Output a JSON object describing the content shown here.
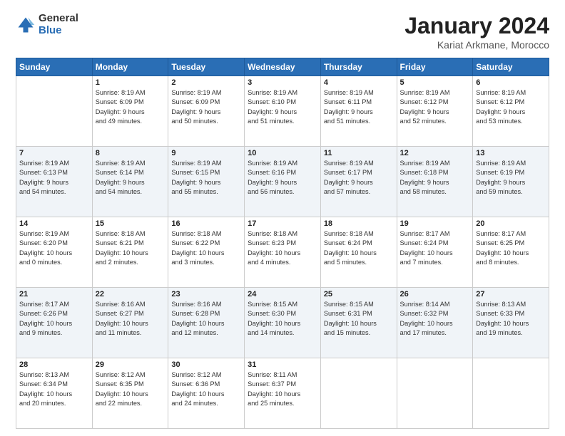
{
  "header": {
    "logo_general": "General",
    "logo_blue": "Blue",
    "title": "January 2024",
    "location": "Kariat Arkmane, Morocco"
  },
  "weekdays": [
    "Sunday",
    "Monday",
    "Tuesday",
    "Wednesday",
    "Thursday",
    "Friday",
    "Saturday"
  ],
  "weeks": [
    [
      {
        "day": "",
        "info": ""
      },
      {
        "day": "1",
        "info": "Sunrise: 8:19 AM\nSunset: 6:09 PM\nDaylight: 9 hours\nand 49 minutes."
      },
      {
        "day": "2",
        "info": "Sunrise: 8:19 AM\nSunset: 6:09 PM\nDaylight: 9 hours\nand 50 minutes."
      },
      {
        "day": "3",
        "info": "Sunrise: 8:19 AM\nSunset: 6:10 PM\nDaylight: 9 hours\nand 51 minutes."
      },
      {
        "day": "4",
        "info": "Sunrise: 8:19 AM\nSunset: 6:11 PM\nDaylight: 9 hours\nand 51 minutes."
      },
      {
        "day": "5",
        "info": "Sunrise: 8:19 AM\nSunset: 6:12 PM\nDaylight: 9 hours\nand 52 minutes."
      },
      {
        "day": "6",
        "info": "Sunrise: 8:19 AM\nSunset: 6:12 PM\nDaylight: 9 hours\nand 53 minutes."
      }
    ],
    [
      {
        "day": "7",
        "info": "Sunrise: 8:19 AM\nSunset: 6:13 PM\nDaylight: 9 hours\nand 54 minutes."
      },
      {
        "day": "8",
        "info": "Sunrise: 8:19 AM\nSunset: 6:14 PM\nDaylight: 9 hours\nand 54 minutes."
      },
      {
        "day": "9",
        "info": "Sunrise: 8:19 AM\nSunset: 6:15 PM\nDaylight: 9 hours\nand 55 minutes."
      },
      {
        "day": "10",
        "info": "Sunrise: 8:19 AM\nSunset: 6:16 PM\nDaylight: 9 hours\nand 56 minutes."
      },
      {
        "day": "11",
        "info": "Sunrise: 8:19 AM\nSunset: 6:17 PM\nDaylight: 9 hours\nand 57 minutes."
      },
      {
        "day": "12",
        "info": "Sunrise: 8:19 AM\nSunset: 6:18 PM\nDaylight: 9 hours\nand 58 minutes."
      },
      {
        "day": "13",
        "info": "Sunrise: 8:19 AM\nSunset: 6:19 PM\nDaylight: 9 hours\nand 59 minutes."
      }
    ],
    [
      {
        "day": "14",
        "info": "Sunrise: 8:19 AM\nSunset: 6:20 PM\nDaylight: 10 hours\nand 0 minutes."
      },
      {
        "day": "15",
        "info": "Sunrise: 8:18 AM\nSunset: 6:21 PM\nDaylight: 10 hours\nand 2 minutes."
      },
      {
        "day": "16",
        "info": "Sunrise: 8:18 AM\nSunset: 6:22 PM\nDaylight: 10 hours\nand 3 minutes."
      },
      {
        "day": "17",
        "info": "Sunrise: 8:18 AM\nSunset: 6:23 PM\nDaylight: 10 hours\nand 4 minutes."
      },
      {
        "day": "18",
        "info": "Sunrise: 8:18 AM\nSunset: 6:24 PM\nDaylight: 10 hours\nand 5 minutes."
      },
      {
        "day": "19",
        "info": "Sunrise: 8:17 AM\nSunset: 6:24 PM\nDaylight: 10 hours\nand 7 minutes."
      },
      {
        "day": "20",
        "info": "Sunrise: 8:17 AM\nSunset: 6:25 PM\nDaylight: 10 hours\nand 8 minutes."
      }
    ],
    [
      {
        "day": "21",
        "info": "Sunrise: 8:17 AM\nSunset: 6:26 PM\nDaylight: 10 hours\nand 9 minutes."
      },
      {
        "day": "22",
        "info": "Sunrise: 8:16 AM\nSunset: 6:27 PM\nDaylight: 10 hours\nand 11 minutes."
      },
      {
        "day": "23",
        "info": "Sunrise: 8:16 AM\nSunset: 6:28 PM\nDaylight: 10 hours\nand 12 minutes."
      },
      {
        "day": "24",
        "info": "Sunrise: 8:15 AM\nSunset: 6:30 PM\nDaylight: 10 hours\nand 14 minutes."
      },
      {
        "day": "25",
        "info": "Sunrise: 8:15 AM\nSunset: 6:31 PM\nDaylight: 10 hours\nand 15 minutes."
      },
      {
        "day": "26",
        "info": "Sunrise: 8:14 AM\nSunset: 6:32 PM\nDaylight: 10 hours\nand 17 minutes."
      },
      {
        "day": "27",
        "info": "Sunrise: 8:13 AM\nSunset: 6:33 PM\nDaylight: 10 hours\nand 19 minutes."
      }
    ],
    [
      {
        "day": "28",
        "info": "Sunrise: 8:13 AM\nSunset: 6:34 PM\nDaylight: 10 hours\nand 20 minutes."
      },
      {
        "day": "29",
        "info": "Sunrise: 8:12 AM\nSunset: 6:35 PM\nDaylight: 10 hours\nand 22 minutes."
      },
      {
        "day": "30",
        "info": "Sunrise: 8:12 AM\nSunset: 6:36 PM\nDaylight: 10 hours\nand 24 minutes."
      },
      {
        "day": "31",
        "info": "Sunrise: 8:11 AM\nSunset: 6:37 PM\nDaylight: 10 hours\nand 25 minutes."
      },
      {
        "day": "",
        "info": ""
      },
      {
        "day": "",
        "info": ""
      },
      {
        "day": "",
        "info": ""
      }
    ]
  ]
}
